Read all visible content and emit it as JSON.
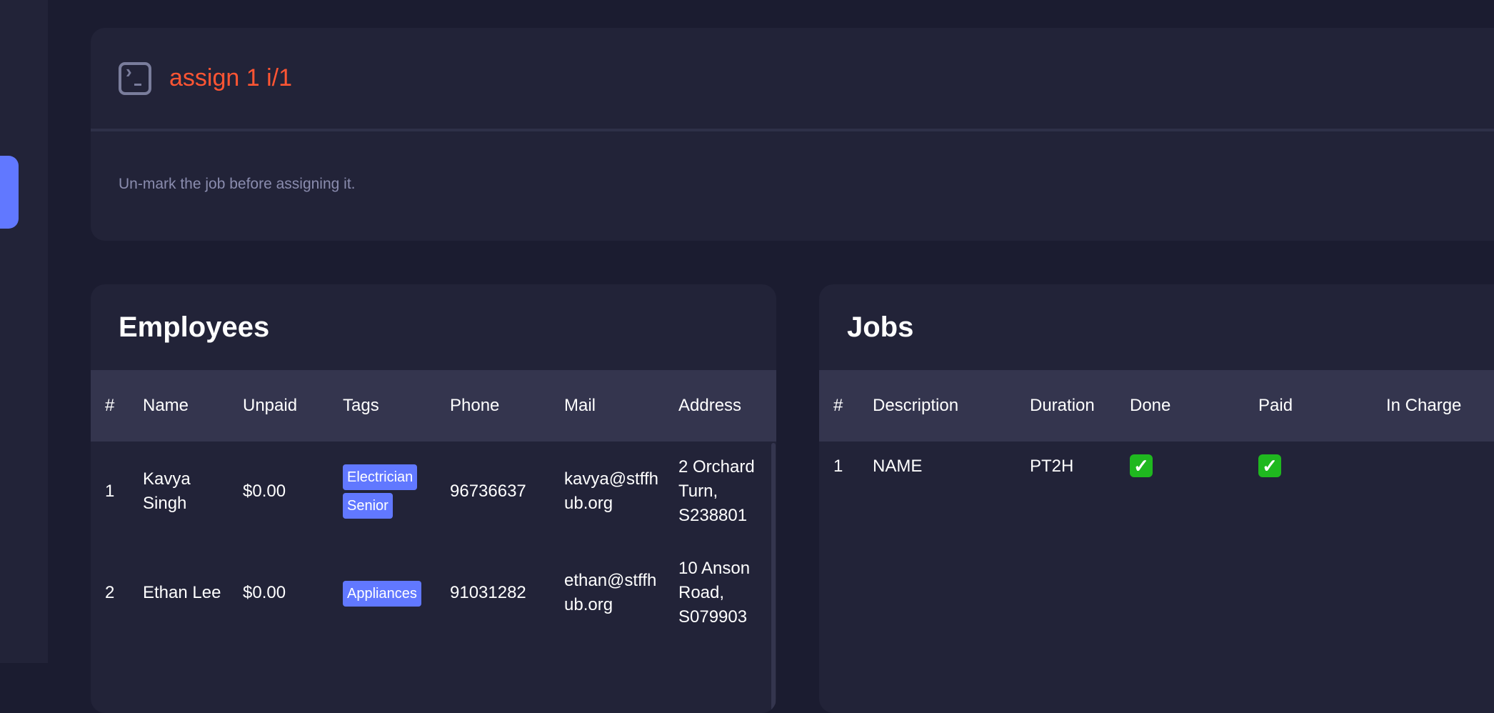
{
  "command": {
    "text": "assign 1 i/1",
    "message": "Un-mark the job before assigning it."
  },
  "employees": {
    "title": "Employees",
    "columns": [
      "#",
      "Name",
      "Unpaid",
      "Tags",
      "Phone",
      "Mail",
      "Address"
    ],
    "rows": [
      {
        "index": "1",
        "name": "Kavya Singh",
        "unpaid": "$0.00",
        "tags": [
          "Electrician",
          "Senior"
        ],
        "phone": "96736637",
        "mail": "kavya@stffhub.org",
        "address": "2 Orchard Turn, S238801"
      },
      {
        "index": "2",
        "name": "Ethan Lee",
        "unpaid": "$0.00",
        "tags": [
          "Appliances"
        ],
        "phone": "91031282",
        "mail": "ethan@stffhub.org",
        "address": "10 Anson Road, S079903"
      }
    ]
  },
  "jobs": {
    "title": "Jobs",
    "columns": [
      "#",
      "Description",
      "Duration",
      "Done",
      "Paid",
      "In Charge"
    ],
    "rows": [
      {
        "index": "1",
        "description": "NAME",
        "duration": "PT2H",
        "done": "✓",
        "paid": "✓",
        "in_charge": ""
      }
    ]
  },
  "colors": {
    "accent": "#6178ff",
    "command": "#ff5533",
    "done": "#1fb81f"
  }
}
